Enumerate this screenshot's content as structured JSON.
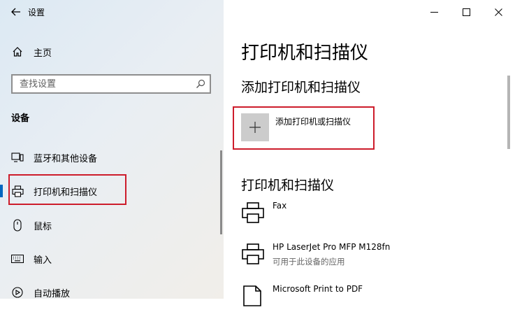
{
  "app": {
    "title": "设置"
  },
  "sidebar": {
    "home_label": "主页",
    "search_placeholder": "查找设置",
    "section_title": "设备",
    "items": [
      {
        "label": "蓝牙和其他设备",
        "icon": "bluetooth-devices-icon"
      },
      {
        "label": "打印机和扫描仪",
        "icon": "printer-icon",
        "active": true
      },
      {
        "label": "鼠标",
        "icon": "mouse-icon"
      },
      {
        "label": "输入",
        "icon": "keyboard-icon"
      },
      {
        "label": "自动播放",
        "icon": "autoplay-icon"
      }
    ]
  },
  "main": {
    "page_title": "打印机和扫描仪",
    "add_section_title": "添加打印机和扫描仪",
    "add_button_label": "添加打印机或扫描仪",
    "list_section_title": "打印机和扫描仪",
    "printers": [
      {
        "name": "Fax",
        "status": ""
      },
      {
        "name": "HP LaserJet Pro MFP M128fn",
        "status": "可用于此设备的应用"
      },
      {
        "name": "Microsoft Print to PDF",
        "status": ""
      }
    ]
  },
  "colors": {
    "accent": "#0067c0",
    "highlight": "#cd1c2b",
    "tile": "#cccccc"
  }
}
